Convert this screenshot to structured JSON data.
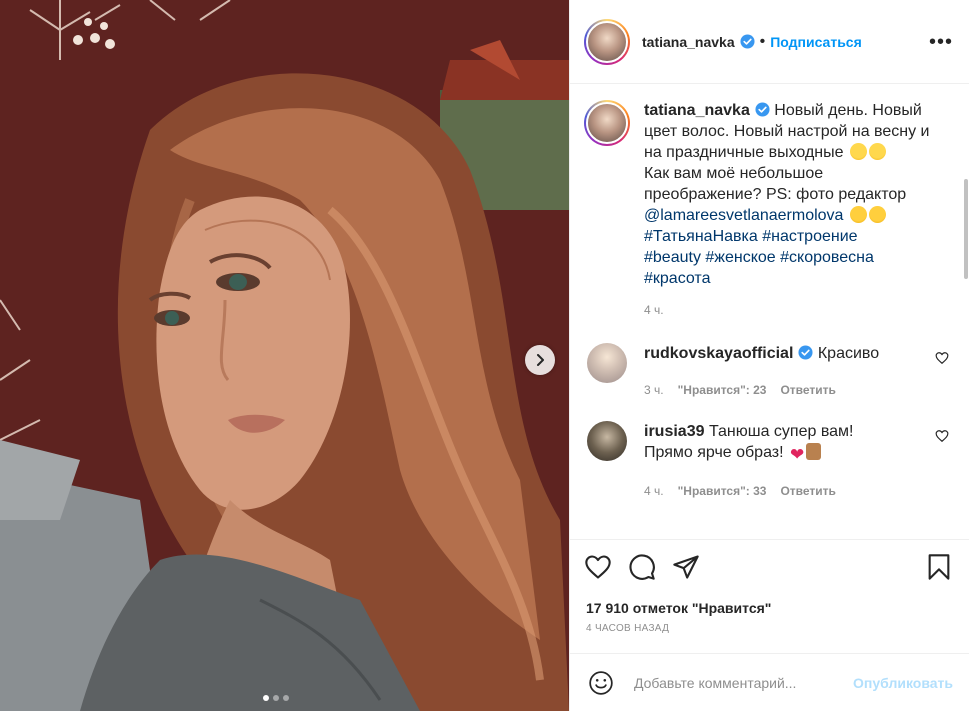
{
  "post": {
    "author": "tatiana_navka",
    "follow_label": "Подписаться",
    "separator": "•",
    "more_label": "•••"
  },
  "caption": {
    "author": "tatiana_navka",
    "text_1": "Новый день. Новый цвет волос. Новый настрой на весну и на праздничные выходные",
    "text_2": "Как вам моё небольшое преображение? PS: фото редактор",
    "mention": "@lamareesvetlanaermolova",
    "hashtags_line1": "#ТатьянаНавка #настроение",
    "hashtags_line2": "#beauty #женское #скоровесна",
    "hashtags_line3": "#красота",
    "time": "4 ч."
  },
  "comments": [
    {
      "author": "rudkovskayaofficial",
      "text": "Красиво",
      "time": "3 ч.",
      "likes": "\"Нравится\": 23",
      "reply": "Ответить"
    },
    {
      "author": "irusia39",
      "text": "Танюша супер вам! Прямо ярче образ!",
      "time": "4 ч.",
      "likes": "\"Нравится\": 33",
      "reply": "Ответить"
    }
  ],
  "stats": {
    "likes": "17 910 отметок \"Нравится\"",
    "ago": "4 ЧАСОВ НАЗАД"
  },
  "composer": {
    "placeholder": "Добавьте комментарий...",
    "publish_label": "Опубликовать"
  },
  "carousel": {
    "current_index": 1,
    "total": 3
  },
  "icons": {
    "verified": "verified-badge-icon",
    "like": "heart-icon",
    "comment": "comment-icon",
    "share": "paper-plane-icon",
    "save": "bookmark-icon",
    "next": "chevron-right-icon",
    "emoji": "smiley-icon"
  },
  "colors": {
    "accent": "#0095f6",
    "link": "#00376b",
    "muted": "#8e8e8e",
    "publish_disabled": "#b2dffc"
  }
}
